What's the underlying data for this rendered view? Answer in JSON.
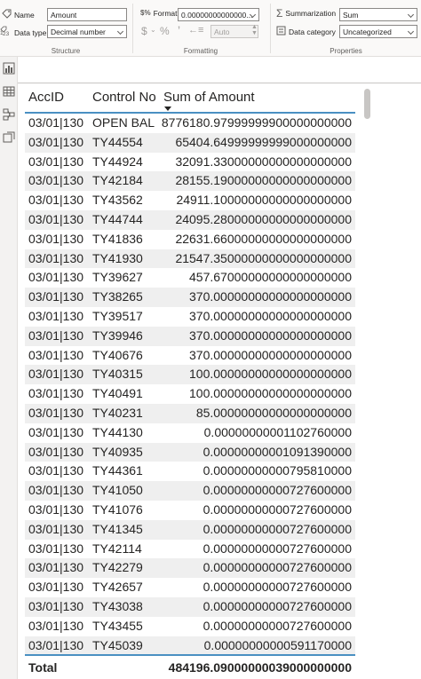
{
  "ribbon": {
    "structure": {
      "label": "Structure",
      "name_label": "Name",
      "name_value": "Amount",
      "datatype_label": "Data type",
      "datatype_value": "Decimal number"
    },
    "formatting": {
      "label": "Formatting",
      "format_label": "Format",
      "format_value": "0.00000000000000...",
      "currency_symbol": "$",
      "percent_symbol": "%",
      "comma_symbol": "ʼ",
      "decimals_value": "Auto"
    },
    "properties": {
      "label": "Properties",
      "summarization_label": "Summarization",
      "summarization_value": "Sum",
      "category_label": "Data category",
      "category_value": "Uncategorized"
    }
  },
  "table": {
    "headers": [
      "AccID",
      "Control No",
      "Sum of Amount"
    ],
    "rows": [
      [
        "03/01|130",
        "OPEN BAL",
        "8776180.97999999900000000000"
      ],
      [
        "03/01|130",
        "TY44554",
        "65404.64999999999000000000"
      ],
      [
        "03/01|130",
        "TY44924",
        "32091.33000000000000000000"
      ],
      [
        "03/01|130",
        "TY42184",
        "28155.19000000000000000000"
      ],
      [
        "03/01|130",
        "TY43562",
        "24911.10000000000000000000"
      ],
      [
        "03/01|130",
        "TY44744",
        "24095.28000000000000000000"
      ],
      [
        "03/01|130",
        "TY41836",
        "22631.66000000000000000000"
      ],
      [
        "03/01|130",
        "TY41930",
        "21547.35000000000000000000"
      ],
      [
        "03/01|130",
        "TY39627",
        "457.67000000000000000000"
      ],
      [
        "03/01|130",
        "TY38265",
        "370.00000000000000000000"
      ],
      [
        "03/01|130",
        "TY39517",
        "370.00000000000000000000"
      ],
      [
        "03/01|130",
        "TY39946",
        "370.00000000000000000000"
      ],
      [
        "03/01|130",
        "TY40676",
        "370.00000000000000000000"
      ],
      [
        "03/01|130",
        "TY40315",
        "100.00000000000000000000"
      ],
      [
        "03/01|130",
        "TY40491",
        "100.00000000000000000000"
      ],
      [
        "03/01|130",
        "TY40231",
        "85.00000000000000000000"
      ],
      [
        "03/01|130",
        "TY44130",
        "0.00000000001102760000"
      ],
      [
        "03/01|130",
        "TY40935",
        "0.00000000001091390000"
      ],
      [
        "03/01|130",
        "TY44361",
        "0.00000000000795810000"
      ],
      [
        "03/01|130",
        "TY41050",
        "0.00000000000727600000"
      ],
      [
        "03/01|130",
        "TY41076",
        "0.00000000000727600000"
      ],
      [
        "03/01|130",
        "TY41345",
        "0.00000000000727600000"
      ],
      [
        "03/01|130",
        "TY42114",
        "0.00000000000727600000"
      ],
      [
        "03/01|130",
        "TY42279",
        "0.00000000000727600000"
      ],
      [
        "03/01|130",
        "TY42657",
        "0.00000000000727600000"
      ],
      [
        "03/01|130",
        "TY43038",
        "0.00000000000727600000"
      ],
      [
        "03/01|130",
        "TY43455",
        "0.00000000000727600000"
      ],
      [
        "03/01|130",
        "TY45039",
        "0.00000000000591170000"
      ]
    ],
    "total_label": "Total",
    "total_value": "484196.09000000039000000000"
  },
  "colors": {
    "accent": "#4a90c2",
    "alt_row": "#efefef"
  }
}
